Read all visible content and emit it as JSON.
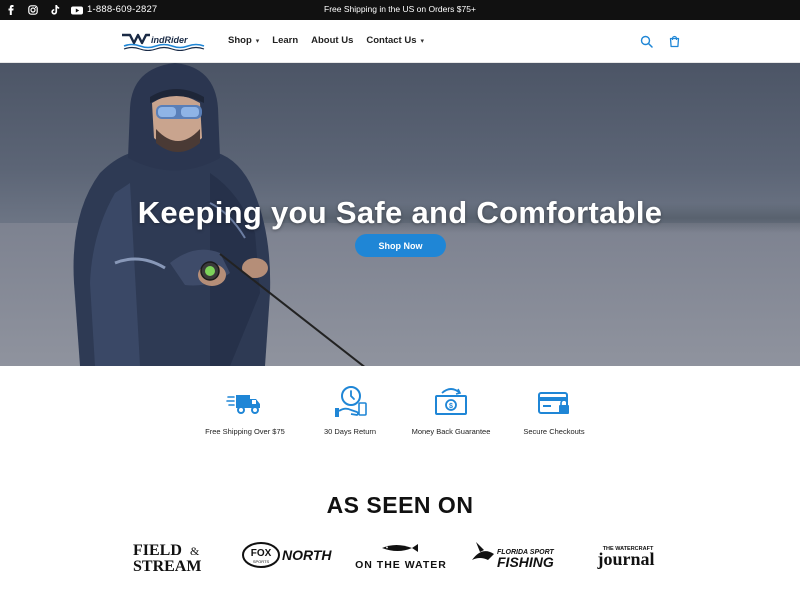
{
  "announcement": {
    "phone": "1-888-609-2827",
    "promo": "Free Shipping in the US on Orders $75+",
    "social_icons": [
      "facebook-icon",
      "instagram-icon",
      "tiktok-icon",
      "youtube-icon"
    ]
  },
  "header": {
    "logo_text": "WindRider",
    "nav": [
      {
        "label": "Shop",
        "has_dropdown": true
      },
      {
        "label": "Learn",
        "has_dropdown": false
      },
      {
        "label": "About Us",
        "has_dropdown": false
      },
      {
        "label": "Contact Us",
        "has_dropdown": true
      }
    ],
    "icons": [
      "search-icon",
      "cart-icon"
    ]
  },
  "hero": {
    "title": "Keeping you Safe and Comfortable",
    "button": "Shop Now"
  },
  "features": [
    {
      "icon": "delivery-truck-icon",
      "label": "Free Shipping Over $75"
    },
    {
      "icon": "clock-return-icon",
      "label": "30 Days Return"
    },
    {
      "icon": "money-back-icon",
      "label": "Money Back Guarantee"
    },
    {
      "icon": "secure-card-icon",
      "label": "Secure Checkouts"
    }
  ],
  "seen_on": {
    "title": "AS SEEN ON",
    "logos": [
      {
        "name": "field-stream-logo",
        "line1": "FIELD",
        "line2": "STREAM",
        "amp": "&"
      },
      {
        "name": "fox-sports-north-logo",
        "badge": "FOX",
        "sub": "SPORTS",
        "text": "NORTH"
      },
      {
        "name": "on-the-water-logo",
        "text": "ON THE WATER"
      },
      {
        "name": "florida-sport-fishing-logo",
        "line1": "FLORIDA SPORT",
        "line2": "FISHING"
      },
      {
        "name": "watercraft-journal-logo",
        "line1": "THE WATERCRAFT",
        "line2": "journal"
      }
    ]
  },
  "colors": {
    "accent": "#1f86d6",
    "topbar": "#111111"
  }
}
